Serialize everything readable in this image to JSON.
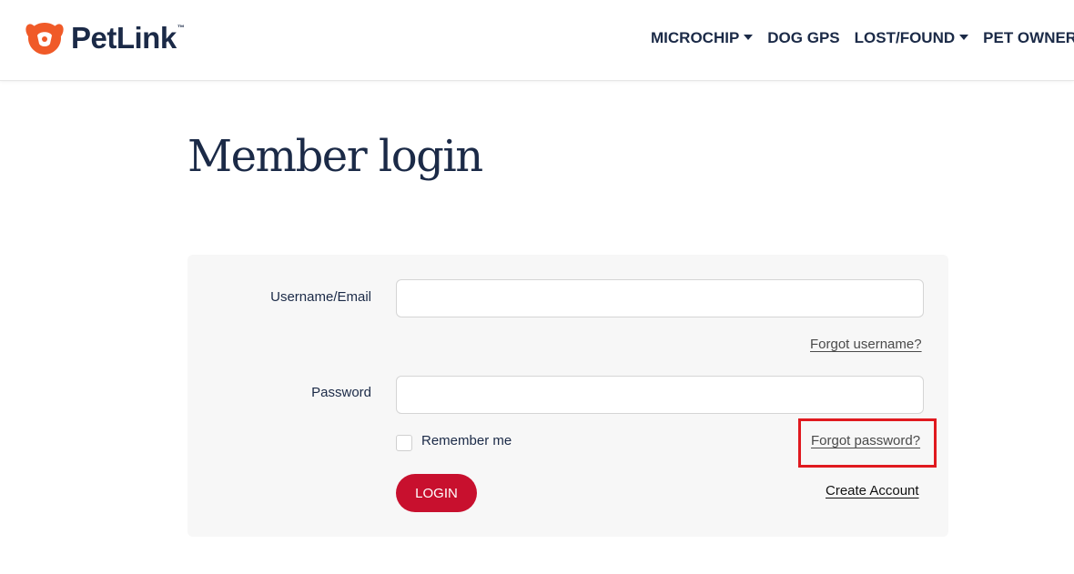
{
  "header": {
    "brand": "PetLink",
    "trademark": "™",
    "nav": [
      {
        "label": "MICROCHIP",
        "dropdown": true
      },
      {
        "label": "DOG GPS",
        "dropdown": false
      },
      {
        "label": "LOST/FOUND",
        "dropdown": true
      },
      {
        "label": "PET OWNER",
        "dropdown": false
      }
    ]
  },
  "main": {
    "title": "Member login"
  },
  "form": {
    "username_label": "Username/Email",
    "username_value": "",
    "forgot_username": "Forgot username?",
    "password_label": "Password",
    "password_value": "",
    "remember_label": "Remember me",
    "remember_checked": false,
    "forgot_password": "Forgot password?",
    "login_label": "LOGIN",
    "create_account": "Create Account"
  },
  "colors": {
    "brand_navy": "#1b2a47",
    "brand_orange": "#f05a28",
    "login_red": "#c8102e",
    "card_bg": "#f7f7f7",
    "annotation_red": "#e0191f"
  },
  "icons": {
    "logo": "petlink-logo-icon",
    "dropdown": "caret-down-icon"
  }
}
